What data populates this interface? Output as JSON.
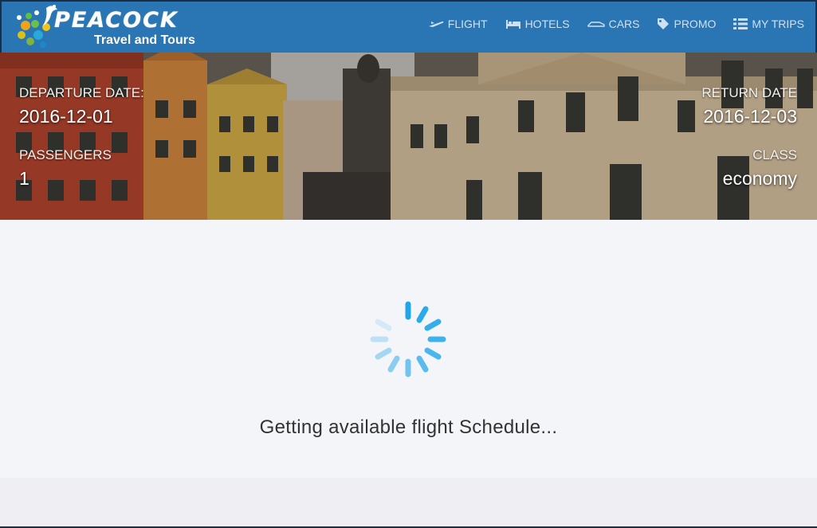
{
  "brand": {
    "name": "PEACOCK",
    "tagline": "Travel and Tours"
  },
  "nav": [
    {
      "label": "FLIGHT",
      "icon": "plane-icon"
    },
    {
      "label": "HOTELS",
      "icon": "bed-icon"
    },
    {
      "label": "CARS",
      "icon": "car-icon"
    },
    {
      "label": "PROMO",
      "icon": "tag-icon"
    },
    {
      "label": "MY TRIPS",
      "icon": "list-icon"
    }
  ],
  "trip": {
    "departure_label": "DEPARTURE DATE:",
    "departure_value": "2016-12-01",
    "return_label": "RETURN DATE",
    "return_value": "2016-12-03",
    "passengers_label": "PASSENGERS",
    "passengers_value": "1",
    "class_label": "CLASS",
    "class_value": "economy"
  },
  "loading": {
    "message": "Getting available flight Schedule..."
  },
  "colors": {
    "header": "#2a76b4",
    "spinner": "#1fa6e8",
    "background": "#f4f5f9"
  }
}
